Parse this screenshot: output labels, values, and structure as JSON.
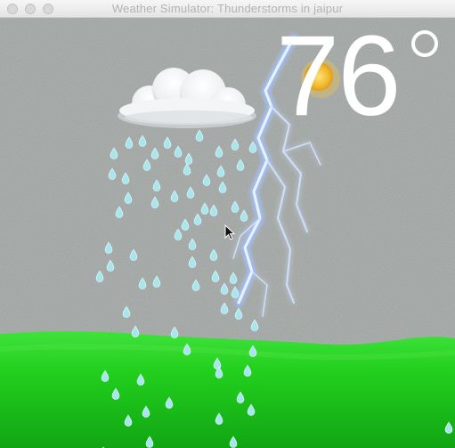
{
  "window": {
    "title": "Weather Simulator: Thunderstorms in jaipur"
  },
  "weather": {
    "temperature": "76",
    "condition_icons": [
      "cloud-icon",
      "sun-icon",
      "lightning-icon",
      "raindrop-icon"
    ]
  },
  "colors": {
    "sky": "#9a9c98",
    "grass": "#22d01c",
    "rain": "#a8e6ee",
    "lightning": "#8fb4f4",
    "sun": "#f3c43a"
  }
}
